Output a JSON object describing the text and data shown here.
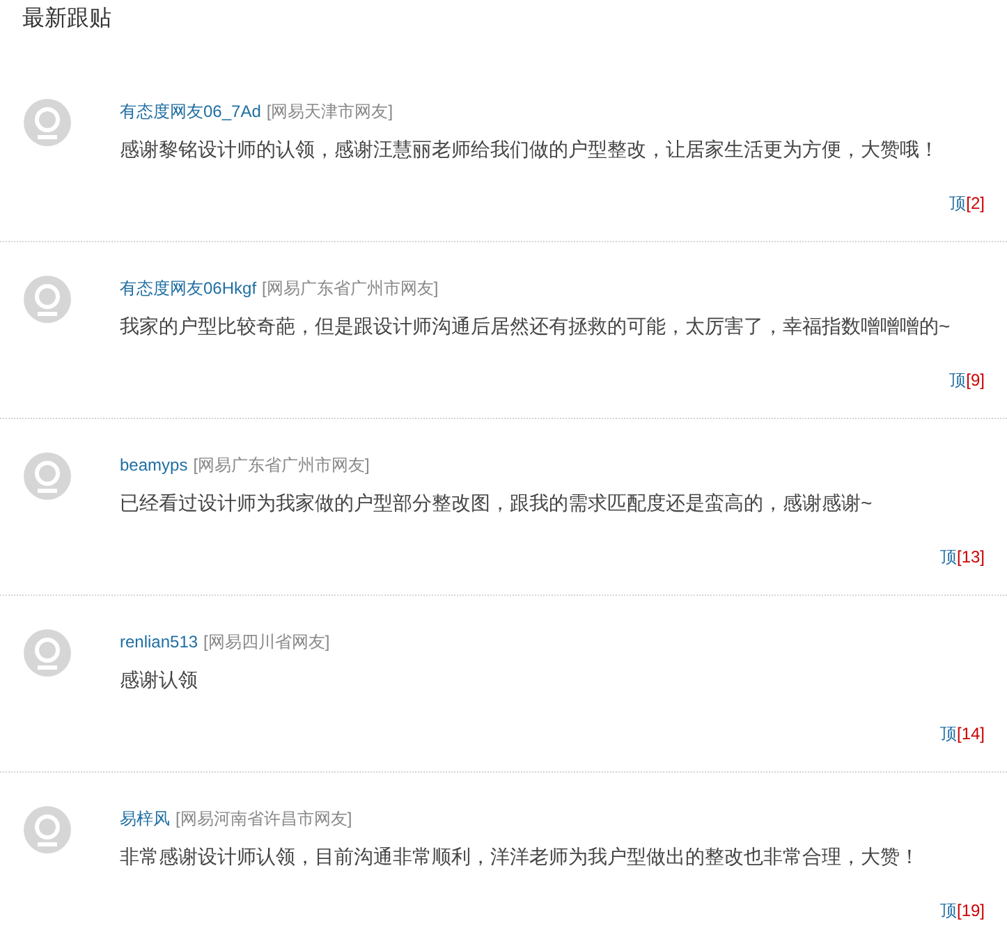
{
  "title": "最新跟贴",
  "comments": [
    {
      "user": "有态度网友06_7Ad",
      "location": "[网易天津市网友]",
      "text": "感谢黎铭设计师的认领，感谢汪慧丽老师给我们做的户型整改，让居家生活更为方便，大赞哦！",
      "vote_label": "顶",
      "vote_count": "[2]"
    },
    {
      "user": "有态度网友06Hkgf",
      "location": "[网易广东省广州市网友]",
      "text": "我家的户型比较奇葩，但是跟设计师沟通后居然还有拯救的可能，太厉害了，幸福指数噌噌噌的~",
      "vote_label": "顶",
      "vote_count": "[9]"
    },
    {
      "user": "beamyps",
      "location": "[网易广东省广州市网友]",
      "text": "已经看过设计师为我家做的户型部分整改图，跟我的需求匹配度还是蛮高的，感谢感谢~",
      "vote_label": "顶",
      "vote_count": "[13]"
    },
    {
      "user": "renlian513",
      "location": "[网易四川省网友]",
      "text": "感谢认领",
      "vote_label": "顶",
      "vote_count": "[14]"
    },
    {
      "user": "易梓风",
      "location": "[网易河南省许昌市网友]",
      "text": "非常感谢设计师认领，目前沟通非常顺利，洋洋老师为我户型做出的整改也非常合理，大赞！",
      "vote_label": "顶",
      "vote_count": "[19]"
    }
  ]
}
